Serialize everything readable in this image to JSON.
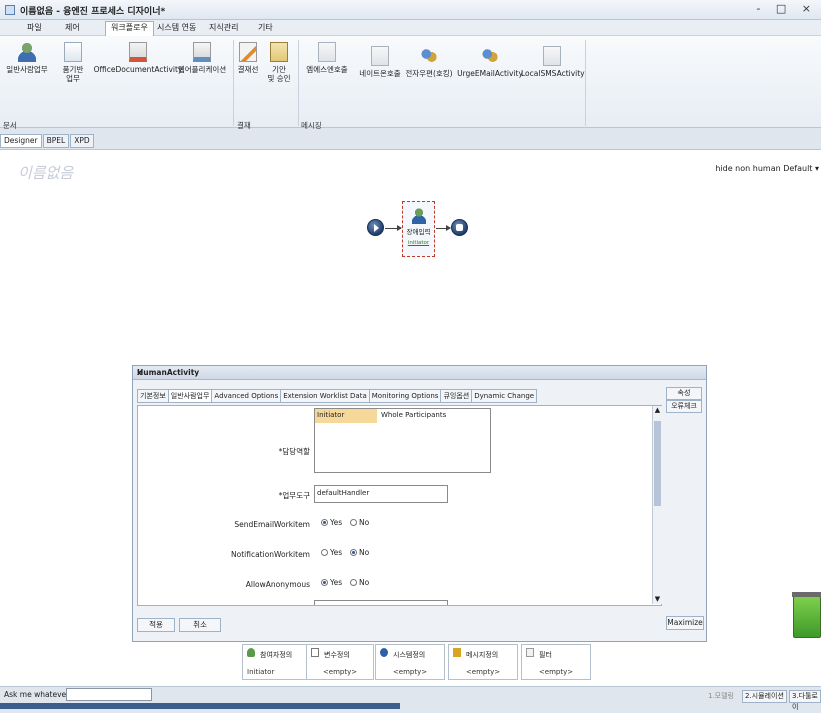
{
  "window": {
    "title": "이름없음 - 융엔진 프로세스 디자이너*",
    "controls": "- □ ×"
  },
  "menubar": {
    "items": [
      {
        "label": "파일"
      },
      {
        "label": "제어"
      },
      {
        "label": "워크플로우"
      },
      {
        "label": "시스템 연동"
      },
      {
        "label": "지식관리"
      },
      {
        "label": "기타"
      }
    ],
    "active": "워크플로우"
  },
  "ribbon": {
    "doc_buttons": [
      {
        "label": "일반사람업무",
        "icon": "user-icon"
      },
      {
        "label": "품기반\n업무",
        "icon": "document-icon"
      },
      {
        "label": "OfficeDocumentActivity",
        "icon": "powerpoint-icon"
      },
      {
        "label": "웹어플리케이션",
        "icon": "web-app-icon"
      }
    ],
    "approval_buttons": [
      {
        "label": "결재선",
        "icon": "pen-document-icon"
      },
      {
        "label": "기안\n및 승인",
        "icon": "clipboard-icon"
      }
    ],
    "message_buttons": [
      {
        "label": "엠에스엔호출",
        "icon": "message-icon"
      },
      {
        "label": "네이트온호출",
        "icon": "message-icon"
      },
      {
        "label": "전자우편(호킹)",
        "icon": "people-mail-icon"
      },
      {
        "label": "UrgeEMailActivity",
        "icon": "people-mail-icon"
      },
      {
        "label": "LocalSMSActivity",
        "icon": "message-icon"
      }
    ],
    "groups": {
      "doc": "문서",
      "approval": "결재",
      "message": "메시징"
    }
  },
  "view_tabs": [
    {
      "label": "Designer"
    },
    {
      "label": "BPEL"
    },
    {
      "label": "XPD"
    }
  ],
  "canvas": {
    "title": "이름없음",
    "options": "hide non human Default ▾",
    "activity_label": "장애입력",
    "activity_sub": "initiator"
  },
  "dialog": {
    "title": "HumanActivity",
    "close": "x",
    "tabs": [
      {
        "label": "기본정보"
      },
      {
        "label": "일반사람업무"
      },
      {
        "label": "Advanced Options"
      },
      {
        "label": "Extension Worklist Data"
      },
      {
        "label": "Monitoring Options"
      },
      {
        "label": "큐잉옵션"
      },
      {
        "label": "Dynamic Change"
      }
    ],
    "fields": {
      "role_label": "담당역할",
      "role_items": [
        "Initiator",
        "Whole Participants"
      ],
      "tool_label": "업무도구",
      "tool_value": "defaultHandler",
      "send_email_label": "SendEmailWorkitem",
      "notification_label": "NotificationWorkitem",
      "anonymous_label": "AllowAnonymous",
      "yes": "Yes",
      "no": "No"
    },
    "radios": {
      "send_email": "Yes",
      "notification": "No",
      "anonymous": "Yes"
    },
    "side_buttons": [
      "속성",
      "오류체크"
    ],
    "apply": "적용",
    "cancel": "취소",
    "maximize": "Maximize"
  },
  "bottom_panel": [
    {
      "label": "참여자정의",
      "value": "Initiator",
      "icon": "user-icon"
    },
    {
      "label": "변수정의",
      "value": "<empty>",
      "icon": "variable-icon"
    },
    {
      "label": "시스템정의",
      "value": "<empty>",
      "icon": "system-icon"
    },
    {
      "label": "메시지정의",
      "value": "<empty>",
      "icon": "message-icon"
    },
    {
      "label": "필터",
      "value": "<empty>",
      "icon": "filter-icon"
    }
  ],
  "statusbar": {
    "ask_label": "Ask me whatever :",
    "tabs": [
      {
        "label": "1.모델링",
        "dim": true
      },
      {
        "label": "2.시뮬레이션",
        "dim": false
      },
      {
        "label": "3.다툴로이",
        "dim": false
      }
    ]
  },
  "colors": {
    "accent": "#2f5fa8",
    "highlight": "#f6d89a",
    "trash": "#5fb53a"
  }
}
